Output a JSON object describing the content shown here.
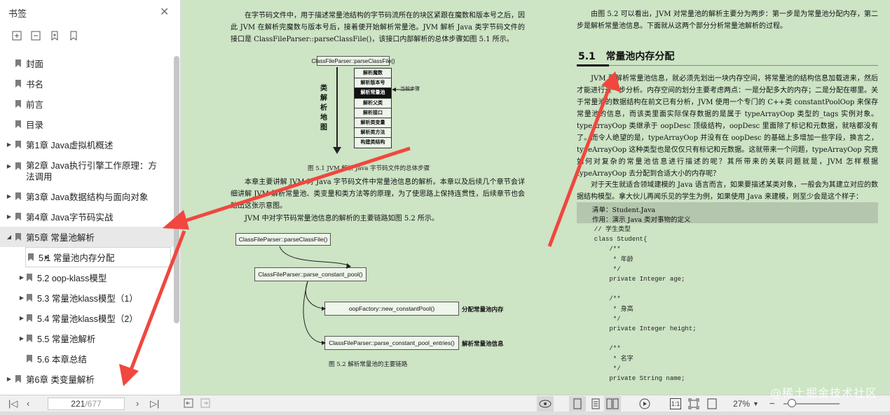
{
  "sidebar": {
    "title": "书签",
    "items": [
      {
        "label": "封面",
        "level": 0,
        "expand": false
      },
      {
        "label": "书名",
        "level": 0,
        "expand": false
      },
      {
        "label": "前言",
        "level": 0,
        "expand": false
      },
      {
        "label": "目录",
        "level": 0,
        "expand": false
      },
      {
        "label": "第1章 Java虚拟机概述",
        "level": 0,
        "expand": "collapsed"
      },
      {
        "label": "第2章 Java执行引擎工作原理：方法调用",
        "level": 0,
        "expand": "collapsed",
        "tall": true
      },
      {
        "label": "第3章 Java数据结构与面向对象",
        "level": 0,
        "expand": "collapsed"
      },
      {
        "label": "第4章 Java字节码实战",
        "level": 0,
        "expand": "collapsed"
      },
      {
        "label": "第5章 常量池解析",
        "level": 0,
        "expand": "expanded",
        "active": true
      },
      {
        "label": "5.1 常量池内存分配",
        "level": 1,
        "expand": "collapsed",
        "sub_active": true
      },
      {
        "label": "5.2 oop-klass模型",
        "level": 1,
        "expand": "collapsed"
      },
      {
        "label": "5.3 常量池klass模型（1）",
        "level": 1,
        "expand": "collapsed"
      },
      {
        "label": "5.4 常量池klass模型（2）",
        "level": 1,
        "expand": "collapsed"
      },
      {
        "label": "5.5 常量池解析",
        "level": 1,
        "expand": "collapsed"
      },
      {
        "label": "5.6 本章总结",
        "level": 1,
        "expand": false
      },
      {
        "label": "第6章 类变量解析",
        "level": 0,
        "expand": "collapsed"
      }
    ]
  },
  "page_left": {
    "para1": "在字节码文件中，用于描述常量池结构的字节码流所在的块区紧跟在魔数和版本号之后，因此 JVM 在解析完魔数与版本号后，接着便开始解析常量池。JVM 解析 Java 类字节码文件的接口是 ClassFileParser::parseClassFile()，该接口内部解析的总体步骤如图 5.1 所示。",
    "fig1": {
      "top_box": "ClassFileParser::parseClassFile()",
      "side_label": "类解析地图",
      "steps": [
        "解析魔数",
        "解析版本号",
        "解析常量池",
        "解析父类",
        "解析接口",
        "解析类变量",
        "解析类方法",
        "构建类结构"
      ],
      "current": "当前步骤",
      "caption": "图 5.1   JVM 解析 Java 字节码文件的总体步骤"
    },
    "para2": "本章主要讲解 JVM 对 Java 字节码文件中常量池信息的解析。本章以及后续几个章节会详细讲解 JVM 解析常量池、类变量和类方法等的原理，为了使思路上保持连贯性，后续章节也会贴出这张示意图。",
    "para3": "JVM 中对字节码常量池信息的解析的主要链路如图 5.2 所示。",
    "fig2": {
      "boxes": [
        "ClassFileParser::parseClassFile()",
        "ClassFileParser::parse_constant_pool()",
        "oopFactory::new_constantPool()",
        "ClassFileParser::parse_constant_pool_entries()"
      ],
      "label_alloc": "分配常量池内存",
      "label_parse": "解析常量池信息",
      "caption": "图 5.2   解析常量池的主要链路"
    }
  },
  "page_right": {
    "intro": "由图 5.2 可以看出，JVM 对常量池的解析主要分为两步：第一步是为常量池分配内存，第二步是解析常量池信息。下面就从这两个部分分析常量池解析的过程。",
    "heading_num": "5.1",
    "heading": "常量池内存分配",
    "para1": "JVM 要解析常量池信息，就必须先划出一块内存空间，将常量池的结构信息加载进来，然后才能进行进一步分析。内存空间的划分主要考虑两点：一是分配多大的内存；二是分配在哪里。关于常量池的数据结构在前文已有分析，JVM 使用一个专门的 C++类 constantPoolOop 来保存常量池的信息，而该类里面实际保存数据的是属于 typeArrayOop 类型的_tags 实例对象。typeArrayOop 类继承于 oopDesc 顶级结构，oopDesc 里面除了标记和元数据，就啥都没有了。而令人绝望的是，typeArrayOop 并没有在 oopDesc 的基础上多增加一些字段，换言之，typeArrayOop 这种类型也是仅仅只有标记和元数据。这就带来一个问题，typeArrayOop 究竟如何对复杂的常量池信息进行描述的呢？其所带来的关联问题就是，JVM 怎样根据 typeArrayOop 去分配到合适大小的内存呢？",
    "para2": "对于天生就适合领域建模的 Java 语言而言，如果要描述某类对象，一般会为其建立对应的数据结构模型。拿大伙儿再闻乐见的学生为例，如果使用 Java 来建模，则至少会是这个样子：",
    "listing_title": "清单：Student.Java",
    "listing_desc": "作用：演示 Java 类对事物的定义",
    "code": "  // 学生类型\n  class Student{\n      /**\n       * 年龄\n       */\n      private Integer age;\n\n      /**\n       * 身高\n       */\n      private Integer height;\n\n      /**\n       * 名字\n       */\n      private String name;\n\n      /**\n       * 年级\n       */"
  },
  "toolbar": {
    "current_page": "221",
    "total_pages": "/677",
    "zoom": "27%"
  },
  "watermark": "@稀土掘金技术社区"
}
